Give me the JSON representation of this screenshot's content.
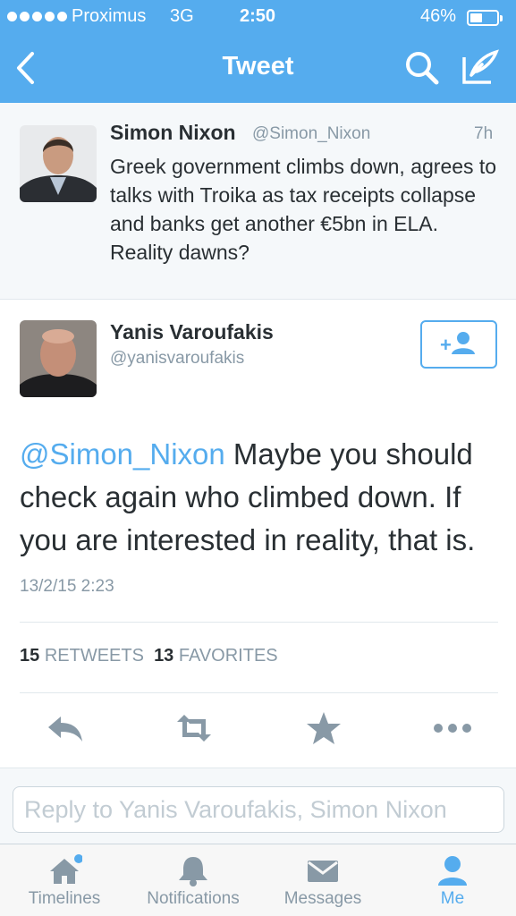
{
  "status_bar": {
    "carrier": "Proximus",
    "network": "3G",
    "time": "2:50",
    "battery": "46%"
  },
  "nav": {
    "title": "Tweet",
    "back_icon": "chevron-left-icon",
    "search_icon": "search-icon",
    "compose_icon": "compose-icon"
  },
  "parent_tweet": {
    "name": "Simon Nixon",
    "handle": "@Simon_Nixon",
    "time": "7h",
    "text": "Greek government climbs down, agrees to talks with Troika as tax receipts collapse and banks get another €5bn in ELA. Reality dawns?"
  },
  "main_tweet": {
    "name": "Yanis Varoufakis",
    "handle": "@yanisvaroufakis",
    "mention": "@Simon_Nixon",
    "text": " Maybe you should check again who climbed down. If you are interested in reality, that is.",
    "date": "13/2/15 2:23",
    "retweets_count": "15",
    "retweets_label": "RETWEETS",
    "favorites_count": "13",
    "favorites_label": "FAVORITES"
  },
  "reply": {
    "placeholder": "Reply to Yanis Varoufakis, Simon Nixon"
  },
  "tabs": [
    {
      "label": "Timelines",
      "icon": "home-icon"
    },
    {
      "label": "Notifications",
      "icon": "bell-icon"
    },
    {
      "label": "Messages",
      "icon": "envelope-icon"
    },
    {
      "label": "Me",
      "icon": "person-icon",
      "active": true
    }
  ],
  "colors": {
    "accent": "#55acee",
    "icon_gray": "#8899a6"
  }
}
